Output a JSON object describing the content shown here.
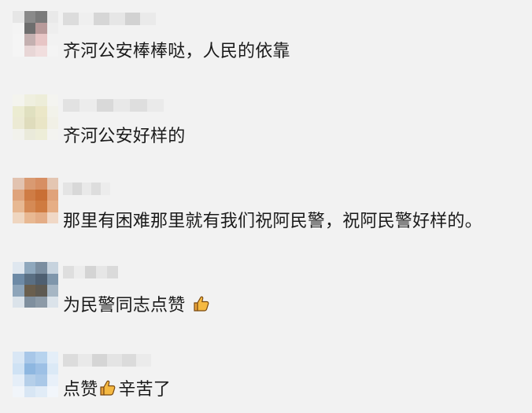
{
  "comments": [
    {
      "text": "齐河公安棒棒哒，人民的依靠",
      "avatar_colors": [
        "#e6e6e6",
        "#8a8a8a",
        "#7a7a7a",
        "#e9e9e9",
        "#f4f4f4",
        "#6e6e6e",
        "#b89a9a",
        "#eeeeee",
        "#f5f5f5",
        "#c4b0b0",
        "#e7c5c5",
        "#f2f2f2",
        "#f5f5f5",
        "#e8d6d6",
        "#f1dede",
        "#f4f4f4"
      ],
      "nick_colors": [
        "#dcdcdc",
        "#efefef",
        "#d6d6d6",
        "#e6e6e6",
        "#d2d2d2",
        "#eaeaea"
      ]
    },
    {
      "text": "齐河公安好样的",
      "avatar_colors": [
        "#f4f4ee",
        "#efefdf",
        "#ededd9",
        "#f4f4f0",
        "#ececd2",
        "#e0e0c0",
        "#ebe7c8",
        "#f2f2ea",
        "#ecead4",
        "#dfdcbc",
        "#e9e5c6",
        "#f1f0e6",
        "#f2f2ec",
        "#eaeada",
        "#ededd8",
        "#f3f3f0"
      ],
      "nick_colors": [
        "#e2e2e2",
        "#ececec",
        "#d9d9d9",
        "#e8e8e8",
        "#dedede",
        "#eaeaea"
      ]
    },
    {
      "text": "那里有困难那里就有我们祝阿民警，祝阿民警好样的。",
      "avatar_colors": [
        "#e2c3b0",
        "#d99a72",
        "#d78f63",
        "#e4c6b2",
        "#dfa47c",
        "#cf7c45",
        "#c96f35",
        "#e0a27a",
        "#e7b892",
        "#d58a55",
        "#cf7b40",
        "#e6ae85",
        "#efd6c0",
        "#e8b892",
        "#e4ad86",
        "#f0d8c6"
      ],
      "nick_colors": [
        "#e4e4e4",
        "#d8d8d8",
        "#e9e9e9",
        "#dddddd",
        "#ececec"
      ]
    },
    {
      "text": "为民警同志点赞",
      "avatar_colors": [
        "#dfe7ef",
        "#8fa8bd",
        "#7b8ea0",
        "#c7d3de",
        "#6d8aa6",
        "#5a6f83",
        "#4e5f71",
        "#7f96ab",
        "#8ea5ba",
        "#6a5f4e",
        "#5e5a52",
        "#a6b6c4",
        "#dbe3ea",
        "#7f8f9e",
        "#8c9aa7",
        "#dbe3ea"
      ],
      "nick_colors": [
        "#dedede",
        "#ececec",
        "#d4d4d4",
        "#e6e6e6",
        "#dadada"
      ]
    },
    {
      "text": "点赞",
      "text_after": "辛苦了",
      "avatar_colors": [
        "#d9e7f5",
        "#a8c7e8",
        "#b7d3ee",
        "#e4eef8",
        "#cfe2f4",
        "#8eb7e0",
        "#9dc0e5",
        "#dbe9f6",
        "#e5eef8",
        "#b5cfe9",
        "#aac8e7",
        "#e8f0f9",
        "#f1f5fa",
        "#d8e6f4",
        "#e1ecf7",
        "#f2f6fb"
      ],
      "nick_colors": [
        "#dcdcdc",
        "#e9e9e9",
        "#d5d5d5",
        "#e4e4e4",
        "#dbdbdb",
        "#ebebeb"
      ]
    }
  ]
}
